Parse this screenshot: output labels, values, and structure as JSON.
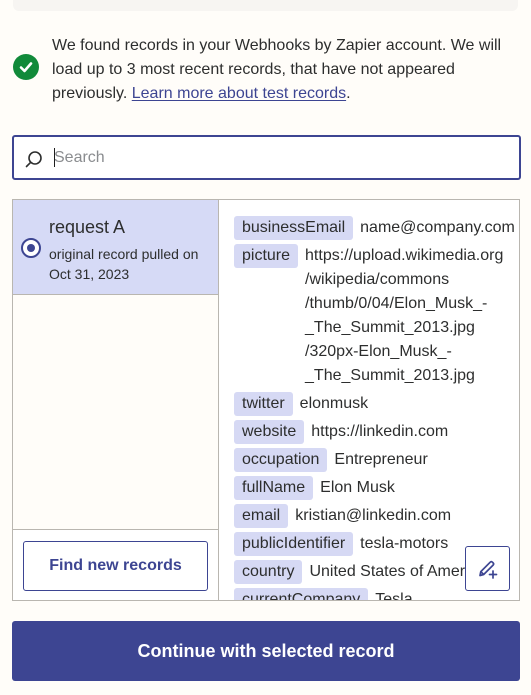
{
  "notice": {
    "text": "We found records in your Webhooks by Zapier account. We will load up to 3 most recent records, that have not appeared previously.",
    "link_label": "Learn more about test records",
    "trailing": ".",
    "icon": "check-circle-icon"
  },
  "search": {
    "placeholder": "Search",
    "value": ""
  },
  "records": [
    {
      "title": "request A",
      "subtitle": "original record pulled on Oct 31, 2023",
      "selected": true
    }
  ],
  "find_button_label": "Find new records",
  "fields": [
    {
      "key": "businessEmail",
      "value": "name@company.com"
    },
    {
      "key": "picture",
      "value": "https://upload.wikimedia.org\n/wikipedia/commons\n/thumb/0/04/Elon_Musk_-\n_The_Summit_2013.jpg\n/320px-Elon_Musk_-\n_The_Summit_2013.jpg"
    },
    {
      "key": "twitter",
      "value": "elonmusk"
    },
    {
      "key": "website",
      "value": "https://linkedin.com"
    },
    {
      "key": "occupation",
      "value": "Entrepreneur"
    },
    {
      "key": "fullName",
      "value": "Elon Musk"
    },
    {
      "key": "email",
      "value": "kristian@linkedin.com"
    },
    {
      "key": "publicIdentifier",
      "value": "tesla-motors"
    },
    {
      "key": "country",
      "value": "United States of America"
    },
    {
      "key": "currentCompany",
      "value": "Tesla"
    }
  ],
  "edit_icon": "edit-pencil-plus-icon",
  "continue_label": "Continue with selected record",
  "colors": {
    "accent": "#3d4592",
    "chip": "#d6d9f4",
    "selected_record": "#d6daf6",
    "success": "#118a3a"
  }
}
